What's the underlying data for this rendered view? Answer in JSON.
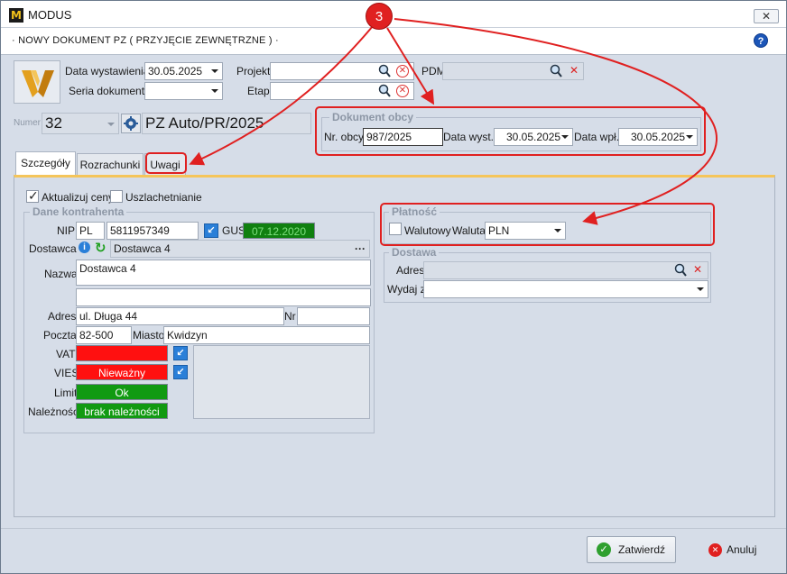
{
  "window": {
    "app_title": "MODUS",
    "logo_letter": "M",
    "close_glyph": "✕"
  },
  "document": {
    "title": "· NOWY DOKUMENT PZ ( PRZYJĘCIE ZEWNĘTRZNE ) ·"
  },
  "header": {
    "data_wystawienia_label": "Data wystawienia",
    "data_wystawienia_value": "30.05.2025",
    "seria_label": "Seria dokumentu",
    "seria_value": "",
    "projekt_label": "Projekt",
    "projekt_value": "",
    "etap_label": "Etap",
    "etap_value": "",
    "pdm_label": "PDM",
    "pdm_value": "",
    "numer_label": "Numer",
    "numer_value": "32",
    "doc_number": "PZ Auto/PR/2025"
  },
  "dokument_obcy": {
    "group_label": "Dokument obcy",
    "nr_obcy_label": "Nr. obcy",
    "nr_obcy_value": "987/2025",
    "data_wyst_label": "Data wyst.",
    "data_wyst_value": "30.05.2025",
    "data_wpl_label": "Data wpł.",
    "data_wpl_value": "30.05.2025"
  },
  "tabs": [
    {
      "label": "Szczegóły",
      "active": true
    },
    {
      "label": "Rozrachunki",
      "active": false
    },
    {
      "label": "Uwagi",
      "active": false
    }
  ],
  "details": {
    "aktualizuj_label": "Aktualizuj ceny",
    "aktualizuj_checked": true,
    "uszlachetnianie_label": "Uszlachetnianie",
    "uszlachetnianie_checked": false
  },
  "kontrahent": {
    "group_label": "Dane kontrahenta",
    "nip_label": "NIP",
    "nip_prefix": "PL",
    "nip_value": "5811957349",
    "gus_label": "GUS",
    "gus_date": "07.12.2020",
    "dostawca_label": "Dostawca",
    "dostawca_value": "Dostawca 4",
    "more_glyph": "···",
    "nazwa_label": "Nazwa",
    "nazwa_value": "Dostawca 4",
    "nazwa_line2": "",
    "adres_label": "Adres",
    "adres_value": "ul. Długa 44",
    "nr_label": "Nr",
    "nr_value": "",
    "poczta_label": "Poczta",
    "poczta_value": "82-500",
    "miasto_label": "Miasto",
    "miasto_value": "Kwidzyn",
    "vat_label": "VAT",
    "vat_value": "",
    "vies_label": "VIES",
    "vies_value": "Nieważny",
    "limit_label": "Limit",
    "limit_value": "Ok",
    "naleznosci_label": "Należności",
    "naleznosci_value": "brak należności"
  },
  "platnosc": {
    "group_label": "Płatność",
    "walutowy_label": "Walutowy",
    "walutowy_checked": false,
    "waluta_label": "Waluta",
    "waluta_value": "PLN"
  },
  "dostawa": {
    "group_label": "Dostawa",
    "adres_label": "Adres",
    "adres_value": "",
    "wydaj_label": "Wydaj z",
    "wydaj_value": ""
  },
  "footer": {
    "confirm_label": "Zatwierdź",
    "cancel_label": "Anuluj"
  },
  "annotation": {
    "callout_number": "3"
  },
  "colors": {
    "accent_red": "#e02020",
    "status_red": "#ff1010",
    "status_green": "#119a11",
    "gus_green": "#108010"
  }
}
